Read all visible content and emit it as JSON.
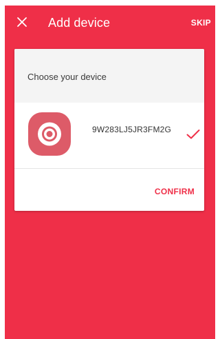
{
  "header": {
    "title": "Add device",
    "skip_label": "SKIP",
    "close_icon": "close-icon"
  },
  "card": {
    "title": "Choose your device",
    "devices": [
      {
        "id": "9W283LJ5JR3FM2G",
        "icon": "camera-lens-icon",
        "selected": true
      }
    ],
    "confirm_label": "CONFIRM"
  },
  "colors": {
    "accent": "#ef2f48",
    "device_icon_bg": "#dd5b68",
    "card_header_bg": "#f4f4f4",
    "card_bg": "#ffffff"
  }
}
